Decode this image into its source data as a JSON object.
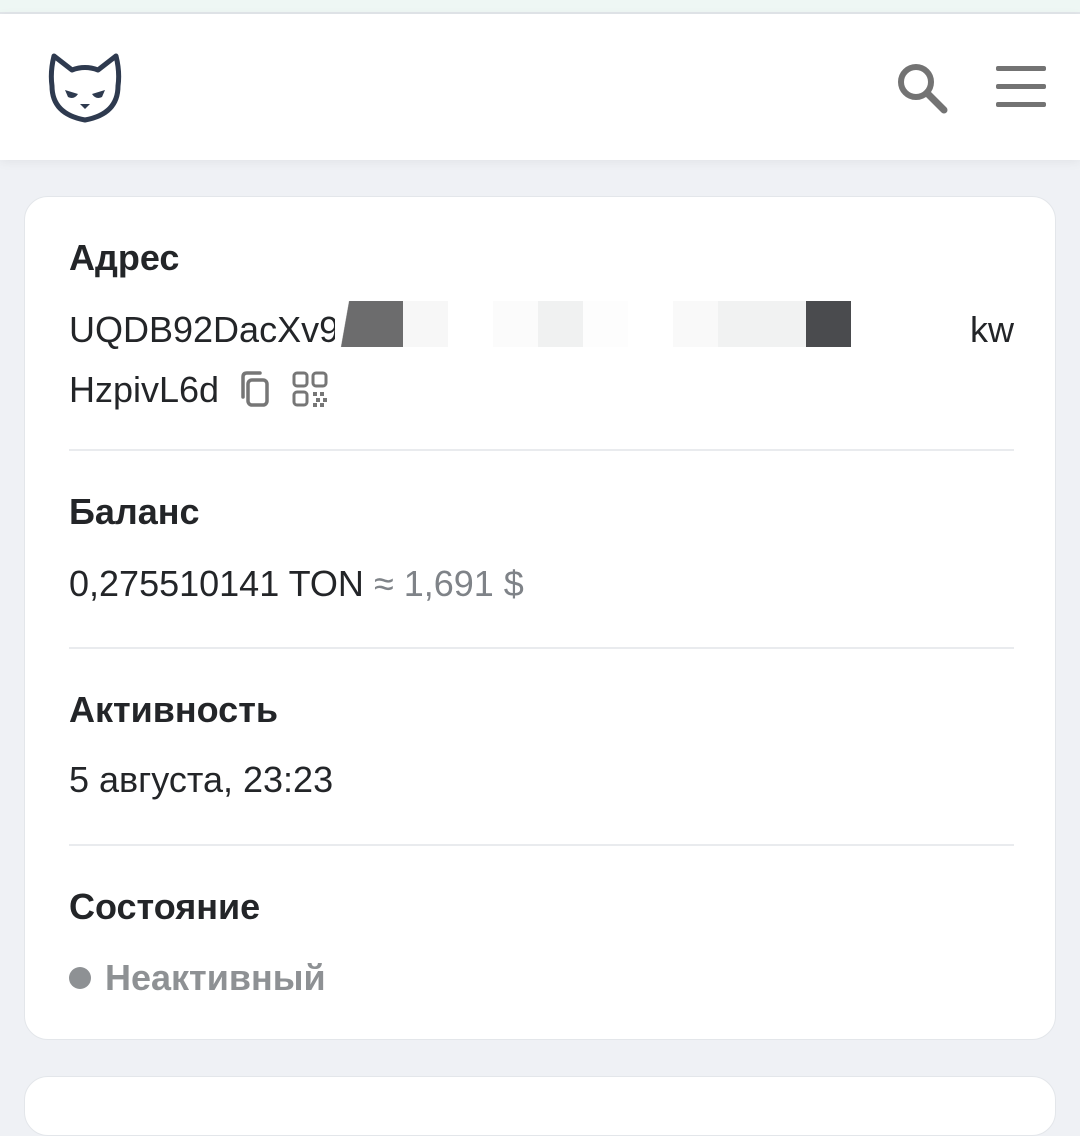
{
  "header": {
    "logo_icon": "cat-logo-icon",
    "search_icon": "search-icon",
    "menu_icon": "hamburger-menu-icon"
  },
  "account": {
    "address_label": "Адрес",
    "address_start": "UQDB92DacXv9",
    "address_end": "kw",
    "address_line2": "HzpivL6d",
    "copy_icon": "copy-icon",
    "qr_icon": "qr-code-icon",
    "balance_label": "Баланс",
    "balance_ton": "0,275510141 TON",
    "balance_usd": "≈ 1,691 $",
    "activity_label": "Активность",
    "activity_value": "5 августа, 23:23",
    "state_label": "Состояние",
    "state_value": "Неактивный"
  },
  "colors": {
    "page_bg": "#eff1f5",
    "card_bg": "#ffffff",
    "text": "#232528",
    "muted": "#8e9194",
    "icon": "#737373",
    "logo": "#2e3a4f"
  }
}
